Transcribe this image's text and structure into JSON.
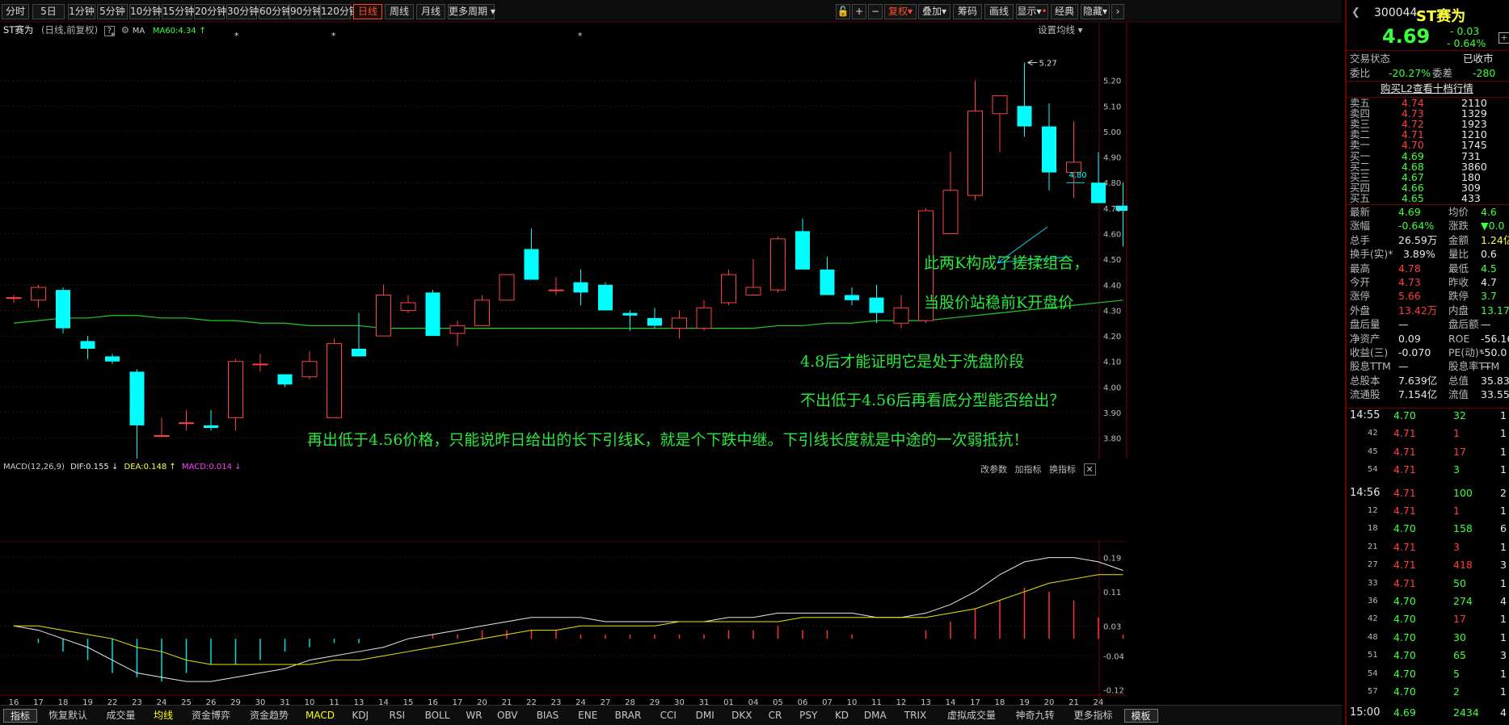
{
  "toolbar": {
    "periods": [
      "分时",
      "5日",
      "1分钟",
      "5分钟",
      "10分钟",
      "15分钟",
      "20分钟",
      "30分钟",
      "60分钟",
      "90分钟",
      "120分钟",
      "日线",
      "周线",
      "月线",
      "更多周期"
    ],
    "right": [
      "复权",
      "叠加",
      "筹码",
      "画线",
      "显示",
      "经典",
      "隐藏"
    ],
    "icons": [
      "lock-icon",
      "plus-icon",
      "minus-icon"
    ]
  },
  "chart_header": {
    "stock": "ST赛为",
    "mode": "(日线,前复权)",
    "help": "?",
    "ma_label": "MA",
    "ma60": "MA60:4.34",
    "ma_arrow": "↑",
    "setting": "设置均线"
  },
  "price_axis": {
    "ticks": [
      "5.20",
      "5.10",
      "5.00",
      "4.90",
      "4.80",
      "4.70",
      "4.60",
      "4.50",
      "4.40",
      "4.30",
      "4.20",
      "4.10",
      "4.00",
      "3.90",
      "3.80"
    ]
  },
  "markers": {
    "high": "5.27",
    "low": "3.70",
    "level": "4.80"
  },
  "chart_data": {
    "type": "candlestick",
    "dates": [
      "16",
      "17",
      "18",
      "19",
      "22",
      "23",
      "24",
      "25",
      "26",
      "29",
      "30",
      "31",
      "11",
      "12",
      "13",
      "14",
      "15",
      "16",
      "17",
      "20",
      "21",
      "22",
      "23",
      "24",
      "25",
      "26",
      "27",
      "28",
      "29",
      "30",
      "31",
      "1",
      "2",
      "3",
      "4",
      "5",
      "6",
      "7",
      "8",
      "9",
      "10",
      "11",
      "12",
      "13",
      "14",
      "15",
      "16",
      "17",
      "18",
      "19",
      "20",
      "21",
      "22",
      "23",
      "24"
    ],
    "ohlc": [
      [
        4.35,
        4.36,
        4.33,
        4.35
      ],
      [
        4.34,
        4.4,
        4.31,
        4.39
      ],
      [
        4.38,
        4.39,
        4.21,
        4.23
      ],
      [
        4.18,
        4.2,
        4.11,
        4.15
      ],
      [
        4.12,
        4.13,
        4.09,
        4.1
      ],
      [
        4.06,
        4.07,
        3.7,
        3.85
      ],
      [
        3.81,
        3.88,
        3.81,
        3.81
      ],
      [
        3.86,
        3.91,
        3.83,
        3.86
      ],
      [
        3.85,
        3.91,
        3.83,
        3.84
      ],
      [
        3.88,
        4.11,
        3.83,
        4.1
      ],
      [
        4.09,
        4.13,
        4.06,
        4.09
      ],
      [
        4.05,
        4.05,
        4.0,
        4.01
      ],
      [
        4.04,
        4.14,
        4.03,
        4.1
      ],
      [
        3.88,
        4.19,
        3.88,
        4.17
      ],
      [
        4.15,
        4.29,
        4.12,
        4.12
      ],
      [
        4.2,
        4.4,
        4.2,
        4.36
      ],
      [
        4.3,
        4.36,
        4.29,
        4.33
      ],
      [
        4.37,
        4.38,
        4.2,
        4.2
      ],
      [
        4.21,
        4.26,
        4.16,
        4.24
      ],
      [
        4.24,
        4.36,
        4.24,
        4.34
      ],
      [
        4.34,
        4.43,
        4.34,
        4.44
      ],
      [
        4.54,
        4.62,
        4.42,
        4.42
      ],
      [
        4.38,
        4.43,
        4.36,
        4.38
      ],
      [
        4.41,
        4.46,
        4.32,
        4.37
      ],
      [
        4.4,
        4.41,
        4.31,
        4.3
      ],
      [
        4.29,
        4.3,
        4.22,
        4.28
      ],
      [
        4.27,
        4.31,
        4.23,
        4.24
      ],
      [
        4.23,
        4.3,
        4.19,
        4.27
      ],
      [
        4.23,
        4.34,
        4.22,
        4.31
      ],
      [
        4.33,
        4.46,
        4.32,
        4.44
      ],
      [
        4.36,
        4.5,
        4.36,
        4.39
      ],
      [
        4.38,
        4.59,
        4.37,
        4.58
      ],
      [
        4.61,
        4.66,
        4.46,
        4.46
      ],
      [
        4.46,
        4.51,
        4.37,
        4.36
      ],
      [
        4.36,
        4.39,
        4.32,
        4.34
      ],
      [
        4.35,
        4.4,
        4.25,
        4.29
      ],
      [
        4.25,
        4.36,
        4.23,
        4.31
      ],
      [
        4.26,
        4.7,
        4.25,
        4.69
      ],
      [
        4.6,
        4.92,
        4.6,
        4.77
      ],
      [
        4.75,
        5.2,
        4.73,
        5.08
      ],
      [
        5.07,
        5.14,
        4.92,
        5.14
      ],
      [
        5.1,
        5.27,
        4.98,
        5.02
      ],
      [
        5.02,
        5.11,
        4.77,
        4.84
      ],
      [
        4.84,
        5.04,
        4.74,
        4.88
      ],
      [
        4.8,
        4.92,
        4.74,
        4.72
      ],
      [
        4.71,
        4.8,
        4.55,
        4.69
      ]
    ],
    "ma60": [
      4.25,
      4.26,
      4.27,
      4.27,
      4.28,
      4.28,
      4.27,
      4.27,
      4.26,
      4.26,
      4.25,
      4.25,
      4.24,
      4.24,
      4.24,
      4.23,
      4.23,
      4.23,
      4.23,
      4.23,
      4.23,
      4.23,
      4.23,
      4.23,
      4.23,
      4.23,
      4.23,
      4.23,
      4.23,
      4.23,
      4.23,
      4.24,
      4.24,
      4.25,
      4.25,
      4.26,
      4.26,
      4.26,
      4.27,
      4.28,
      4.29,
      4.3,
      4.31,
      4.32,
      4.33,
      4.34
    ],
    "ylim": [
      3.72,
      5.3
    ]
  },
  "macd": {
    "title": "MACD(12,26,9)",
    "dif": "DIF:0.155",
    "dif_arrow": "↓",
    "dea": "DEA:0.148",
    "dea_arrow": "↑",
    "macd": "MACD:0.014",
    "macd_arrow": "↓",
    "ticks": [
      "0.19",
      "0.11",
      "0.03",
      "-0.04",
      "-0.12"
    ],
    "actions": [
      "改参数",
      "加指标",
      "换指标"
    ],
    "dif_values": [
      0.03,
      0.02,
      0.0,
      -0.02,
      -0.05,
      -0.08,
      -0.09,
      -0.1,
      -0.1,
      -0.09,
      -0.08,
      -0.07,
      -0.05,
      -0.04,
      -0.03,
      -0.02,
      0.0,
      0.01,
      0.02,
      0.03,
      0.04,
      0.05,
      0.05,
      0.05,
      0.04,
      0.04,
      0.04,
      0.04,
      0.04,
      0.05,
      0.05,
      0.06,
      0.06,
      0.06,
      0.06,
      0.05,
      0.05,
      0.06,
      0.08,
      0.11,
      0.15,
      0.18,
      0.19,
      0.19,
      0.18,
      0.16
    ],
    "dea_values": [
      0.03,
      0.03,
      0.02,
      0.01,
      0.0,
      -0.02,
      -0.03,
      -0.05,
      -0.06,
      -0.06,
      -0.06,
      -0.06,
      -0.06,
      -0.05,
      -0.05,
      -0.04,
      -0.03,
      -0.02,
      -0.01,
      0.0,
      0.01,
      0.02,
      0.02,
      0.03,
      0.03,
      0.03,
      0.03,
      0.04,
      0.04,
      0.04,
      0.04,
      0.04,
      0.05,
      0.05,
      0.05,
      0.05,
      0.05,
      0.05,
      0.06,
      0.07,
      0.09,
      0.11,
      0.13,
      0.14,
      0.15,
      0.15
    ],
    "hist": [
      0.0,
      -0.01,
      -0.03,
      -0.05,
      -0.08,
      -0.09,
      -0.1,
      -0.08,
      -0.06,
      -0.06,
      -0.05,
      -0.03,
      -0.02,
      -0.01,
      -0.01,
      0.0,
      0.0,
      0.01,
      0.01,
      0.02,
      0.02,
      0.02,
      0.02,
      0.01,
      0.01,
      0.01,
      0.01,
      0.01,
      0.01,
      0.02,
      0.02,
      0.03,
      0.02,
      0.02,
      0.01,
      0.0,
      0.0,
      0.02,
      0.04,
      0.07,
      0.09,
      0.12,
      0.11,
      0.09,
      0.05,
      0.01
    ],
    "ylim": [
      -0.13,
      0.21
    ]
  },
  "xaxis": [
    "16",
    "17",
    "18",
    "19",
    "22",
    "23",
    "24",
    "25",
    "26",
    "29",
    "30",
    "31",
    "10",
    "11",
    "13",
    "14",
    "15",
    "16",
    "17",
    "20",
    "21",
    "22",
    "23",
    "24",
    "27",
    "28",
    "29",
    "30",
    "31",
    "01",
    "04",
    "05",
    "06",
    "07",
    "10",
    "11",
    "12",
    "13",
    "14",
    "17",
    "18",
    "19",
    "20",
    "21",
    "24"
  ],
  "annotations": [
    "此两K构成了搓揉组合，",
    "当股价站稳前K开盘价",
    "4.8后才能证明它是处于洗盘阶段",
    "不出低于4.56后再看底分型能否给出？",
    "再出低于4.56价格，只能说昨日给出的长下引线K，就是个下跌中继。下引线长度就是中途的一次弱抵抗！"
  ],
  "bottom_tabs": [
    "指标",
    "恢复默认",
    "成交量",
    "均线",
    "资金博弈",
    "资金趋势",
    "MACD",
    "KDJ",
    "RSI",
    "BOLL",
    "WR",
    "OBV",
    "BIAS",
    "ENE",
    "BRAR",
    "CCI",
    "DMI",
    "DKX",
    "CR",
    "PSY",
    "KD",
    "DMA",
    "TRIX",
    "虚拟成交量",
    "神奇九转",
    "更多指标",
    "模板"
  ],
  "quote": {
    "code": "300044",
    "name": "ST赛为",
    "price": "4.69",
    "change": "- 0.03",
    "pct": "- 0.64%",
    "status_label": "交易状态",
    "status": "已收市",
    "weibi_label": "委比",
    "weibi": "-20.27%",
    "weicha_label": "委差",
    "weicha": "-280",
    "l2": "购买L2查看十档行情",
    "sells": [
      {
        "l": "卖五",
        "p": "4.74",
        "v": "2110"
      },
      {
        "l": "卖四",
        "p": "4.73",
        "v": "1329"
      },
      {
        "l": "卖三",
        "p": "4.72",
        "v": "1923"
      },
      {
        "l": "卖二",
        "p": "4.71",
        "v": "1210"
      },
      {
        "l": "卖一",
        "p": "4.70",
        "v": "1745"
      }
    ],
    "buys": [
      {
        "l": "买一",
        "p": "4.69",
        "v": "731"
      },
      {
        "l": "买二",
        "p": "4.68",
        "v": "3860"
      },
      {
        "l": "买三",
        "p": "4.67",
        "v": "180"
      },
      {
        "l": "买四",
        "p": "4.66",
        "v": "309"
      },
      {
        "l": "买五",
        "p": "4.65",
        "v": "433"
      }
    ],
    "stats": [
      [
        "最新",
        "4.69",
        "均价",
        "4.6"
      ],
      [
        "涨幅",
        "-0.64%",
        "涨跌",
        "▼0.0"
      ],
      [
        "总手",
        "26.59万",
        "金额",
        "1.24亿"
      ],
      [
        "换手(实)*",
        "3.89%",
        "量比",
        "0.6"
      ],
      [
        "最高",
        "4.78",
        "最低",
        "4.5"
      ],
      [
        "今开",
        "4.73",
        "昨收",
        "4.7"
      ],
      [
        "涨停",
        "5.66",
        "跌停",
        "3.7"
      ],
      [
        "外盘",
        "13.42万",
        "内盘",
        "13.17"
      ],
      [
        "盘后量",
        "—",
        "盘后额",
        "—"
      ],
      [
        "净资产",
        "0.09",
        "ROE",
        "-56.16%"
      ],
      [
        "收益(三)",
        "-0.070",
        "PE(动)*",
        "-50.0"
      ],
      [
        "股息TTM",
        "—",
        "股息率TTM",
        "—"
      ],
      [
        "总股本",
        "7.639亿",
        "总值",
        "35.83亿"
      ],
      [
        "流通股",
        "7.154亿",
        "流值",
        "33.55亿"
      ]
    ],
    "ticks": [
      [
        "14:55",
        "4.70",
        "32",
        "1"
      ],
      [
        "42",
        "4.71",
        "1",
        "1"
      ],
      [
        "45",
        "4.71",
        "17",
        "1"
      ],
      [
        "54",
        "4.71",
        "3",
        "1"
      ],
      [
        "14:56",
        "4.71",
        "100",
        "2"
      ],
      [
        "12",
        "4.71",
        "1",
        "1"
      ],
      [
        "18",
        "4.70",
        "158",
        "6"
      ],
      [
        "21",
        "4.71",
        "3",
        "1"
      ],
      [
        "27",
        "4.71",
        "418",
        "3"
      ],
      [
        "33",
        "4.71",
        "50",
        "1"
      ],
      [
        "36",
        "4.70",
        "274",
        "4"
      ],
      [
        "42",
        "4.70",
        "17",
        "1"
      ],
      [
        "48",
        "4.70",
        "30",
        "1"
      ],
      [
        "51",
        "4.70",
        "65",
        "3"
      ],
      [
        "54",
        "4.70",
        "5",
        "1"
      ],
      [
        "57",
        "4.70",
        "2",
        "1"
      ],
      [
        "15:00",
        "4.69",
        "2434",
        "4"
      ]
    ]
  }
}
